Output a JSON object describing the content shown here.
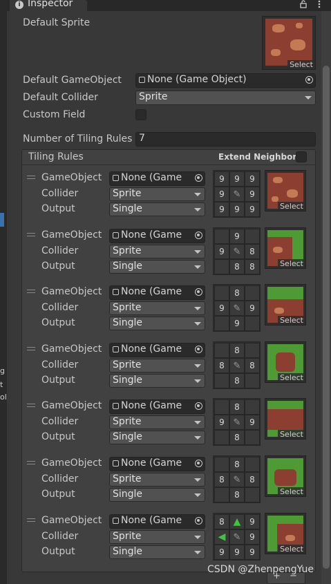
{
  "tab": {
    "title": "Inspector",
    "icons": [
      "lock-icon",
      "menu-icon"
    ]
  },
  "left_strip_chars": [
    "g",
    "t",
    "ol"
  ],
  "default_sprite": {
    "label": "Default Sprite",
    "select": "Select"
  },
  "default_gameobject": {
    "label": "Default GameObject",
    "value": "None (Game Object)"
  },
  "default_collider": {
    "label": "Default Collider",
    "value": "Sprite"
  },
  "custom_field": {
    "label": "Custom Field"
  },
  "number_rules": {
    "label": "Number of Tiling Rules",
    "value": "7"
  },
  "tiling_rules": {
    "title": "Tiling Rules",
    "extend_neighbor": "Extend Neighbor",
    "labels": {
      "gameobject": "GameObject",
      "collider": "Collider",
      "output": "Output"
    },
    "rules": [
      {
        "gameobject": "None (Game",
        "collider": "Sprite",
        "output": "Single",
        "select": "Select",
        "grid": [
          "9",
          "9",
          "9",
          "9",
          "",
          "9",
          "9",
          "9",
          "9"
        ],
        "preview": "dirt"
      },
      {
        "gameobject": "None (Game",
        "collider": "Sprite",
        "output": "Single",
        "select": "Select",
        "grid": [
          "",
          "9",
          "",
          "9",
          "",
          "8",
          "",
          "8",
          "8"
        ],
        "preview": "corner-tr"
      },
      {
        "gameobject": "None (Game",
        "collider": "Sprite",
        "output": "Single",
        "select": "Select",
        "grid": [
          "",
          "8",
          "",
          "9",
          "",
          "9",
          "",
          "9",
          ""
        ],
        "preview": "top"
      },
      {
        "gameobject": "None (Game",
        "collider": "Sprite",
        "output": "Single",
        "select": "Select",
        "grid": [
          "",
          "8",
          "",
          "8",
          "",
          "8",
          "",
          "8",
          ""
        ],
        "preview": "island"
      },
      {
        "gameobject": "None (Game",
        "collider": "Sprite",
        "output": "Single",
        "select": "Select",
        "grid": [
          "",
          "8",
          "",
          "9",
          "",
          "9",
          "",
          "8",
          ""
        ],
        "preview": "band"
      },
      {
        "gameobject": "None (Game",
        "collider": "Sprite",
        "output": "Single",
        "select": "Select",
        "grid": [
          "",
          "8",
          "",
          "8",
          "",
          "8",
          "",
          "8",
          ""
        ],
        "preview": "island2"
      },
      {
        "gameobject": "None (Game",
        "collider": "Sprite",
        "output": "Single",
        "select": "Select",
        "grid": [
          "8",
          "arrow-up",
          "9",
          "arrow-left",
          "",
          "9",
          "9",
          "9",
          "9"
        ],
        "preview": "corner-tl"
      }
    ]
  },
  "footer": {
    "plus": "+",
    "minus": "−"
  },
  "watermark": "CSDN @ZhenpengYue",
  "colors": {
    "bg": "#383838",
    "field": "#2a2a2a",
    "dropdown": "#515151",
    "dirt": "#8c3f31",
    "grass": "#4e9a35",
    "arrow": "#3ec43e"
  }
}
